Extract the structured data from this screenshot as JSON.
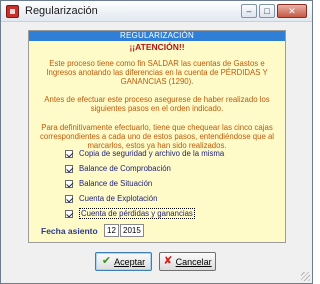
{
  "window": {
    "title": "Regularización",
    "controls": {
      "minimize": "–",
      "maximize": "□",
      "close": "✕"
    }
  },
  "panel": {
    "header": "REGULARIZACIÓN",
    "subheader": "¡¡ATENCIÓN!!",
    "para1": "Este proceso tiene como fin SALDAR las cuentas de Gastos e Ingresos anotando las diferencias en la cuenta de PÉRDIDAS Y GANANCIAS  (1290).",
    "para2": "Antes de efectuar este proceso asegurese de haber realizado los siguientes pasos en el orden indicado.",
    "para3": "Para definitivamente efectuarlo, tiene que chequear las cinco cajas correspondientes a cada uno de estos pasos, entendiéndose que al marcarlos, estos ya han sido realizados.",
    "checklist": [
      {
        "label": "Copia de seguridad y archivo de la misma",
        "checked": true
      },
      {
        "label": "Balance de Comprobación",
        "checked": true
      },
      {
        "label": "Balance de Situación",
        "checked": true
      },
      {
        "label": "Cuenta de Explotación",
        "checked": true
      },
      {
        "label": "Cuenta de pérdidas y ganancias",
        "checked": true
      }
    ],
    "fecha_label": "Fecha asiento",
    "fecha_month": "12",
    "fecha_year": "2015"
  },
  "buttons": {
    "accept": "Aceptar",
    "cancel": "Cancelar",
    "accept_icon": "check-icon",
    "cancel_icon": "x-icon"
  },
  "colors": {
    "panel_bg": "#fefbc9",
    "header_bg": "#2f7fd7",
    "subheader": "#b31515",
    "paragraph": "#c05a0a",
    "label_blue": "#2b3c8f"
  }
}
